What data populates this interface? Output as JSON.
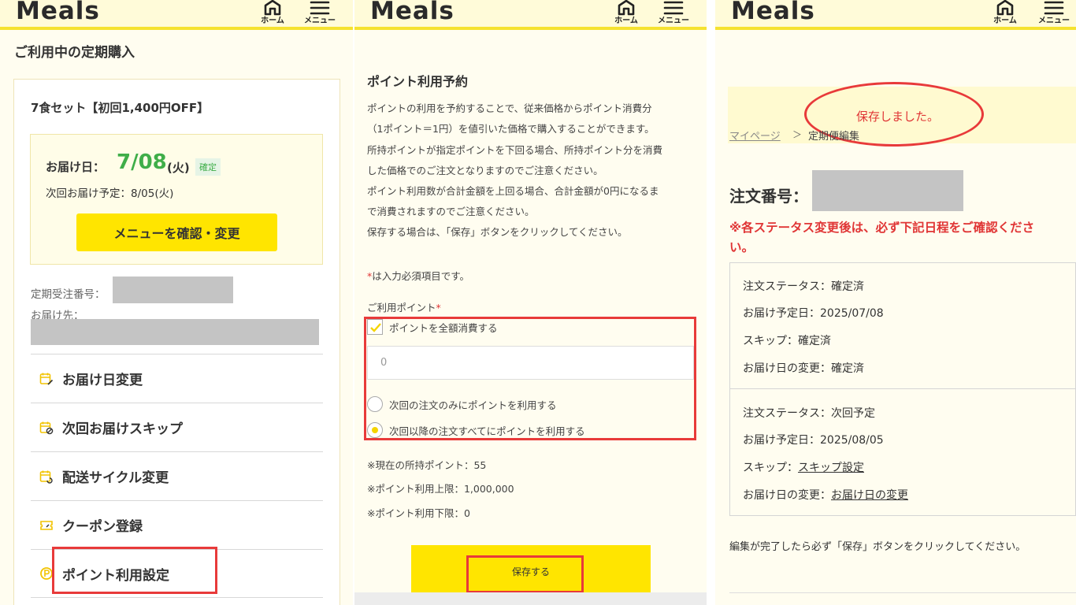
{
  "header": {
    "logo": "Meals",
    "home_label": "ホーム",
    "menu_label": "メニュー"
  },
  "panel1": {
    "title": "ご利用中の定期購入",
    "plan_name": "7食セット【初回1,400円OFF】",
    "delivery_label": "お届け日：",
    "delivery_date": "7/08",
    "delivery_weekday": "(火)",
    "delivery_badge": "確定",
    "next_delivery": "次回お届け予定：8/05(火)",
    "menu_button": "メニューを確認・変更",
    "order_no_label": "定期受注番号：",
    "address_label": "お届け先：",
    "rows": [
      {
        "label": "お届け日変更",
        "icon": "calendar-edit-icon"
      },
      {
        "label": "次回お届けスキップ",
        "icon": "calendar-skip-icon"
      },
      {
        "label": "配送サイクル変更",
        "icon": "calendar-cycle-icon"
      },
      {
        "label": "クーポン登録",
        "icon": "coupon-icon"
      },
      {
        "label": "ポイント利用設定",
        "icon": "point-icon"
      }
    ]
  },
  "panel2": {
    "title": "ポイント利用予約",
    "body": [
      "ポイントの利用を予約することで、従来価格からポイント消費分",
      "（1ポイント＝1円）を値引いた価格で購入することができます。",
      "所持ポイントが指定ポイントを下回る場合、所持ポイント分を消費",
      "した価格でのご注文となりますのでご注意ください。",
      "ポイント利用数が合計金額を上回る場合、合計金額が0円になるま",
      "で消費されますのでご注意ください。",
      "保存する場合は、「保存」ボタンをクリックしてください。"
    ],
    "required_mark": "*",
    "required_note": "は入力必須項目です。",
    "points_label": "ご利用ポイント",
    "use_all_label": "ポイントを全額消費する",
    "points_value": "0",
    "option_next_only": "次回の注文のみにポイントを利用する",
    "option_all_after": "次回以降の注文すべてにポイントを利用する",
    "current_points": "※現在の所持ポイント：55",
    "max_points": "※ポイント利用上限：1,000,000",
    "min_points": "※ポイント利用下限：0",
    "save_button": "保存する"
  },
  "panel3": {
    "saved_message": "保存しました。",
    "breadcrumb_home": "マイページ",
    "breadcrumb_sep": "＞",
    "breadcrumb_current": "定期便編集",
    "order_no_label": "注文番号：",
    "warning_line1": "※各ステータス変更後は、必ず下記日程をご確認くださ",
    "warning_line2": "い。",
    "box1": {
      "status": "注文ステータス：確定済",
      "date": "お届け予定日：2025/07/08",
      "skip": "スキップ：確定済",
      "change": "お届け日の変更：確定済"
    },
    "box2": {
      "status": "注文ステータス：次回予定",
      "date": "お届け予定日：2025/08/05",
      "skip_label": "スキップ：",
      "skip_link": "スキップ設定",
      "change_label": "お届け日の変更：",
      "change_link": "お届け日の変更"
    },
    "footer_note": "編集が完了したら必ず「保存」ボタンをクリックしてください。"
  },
  "colors": {
    "accent_yellow": "#ffe500",
    "header_bg": "#fffbd9",
    "green": "#3fae49",
    "warning_red": "#e03535",
    "highlight_red": "#e83a3a"
  }
}
